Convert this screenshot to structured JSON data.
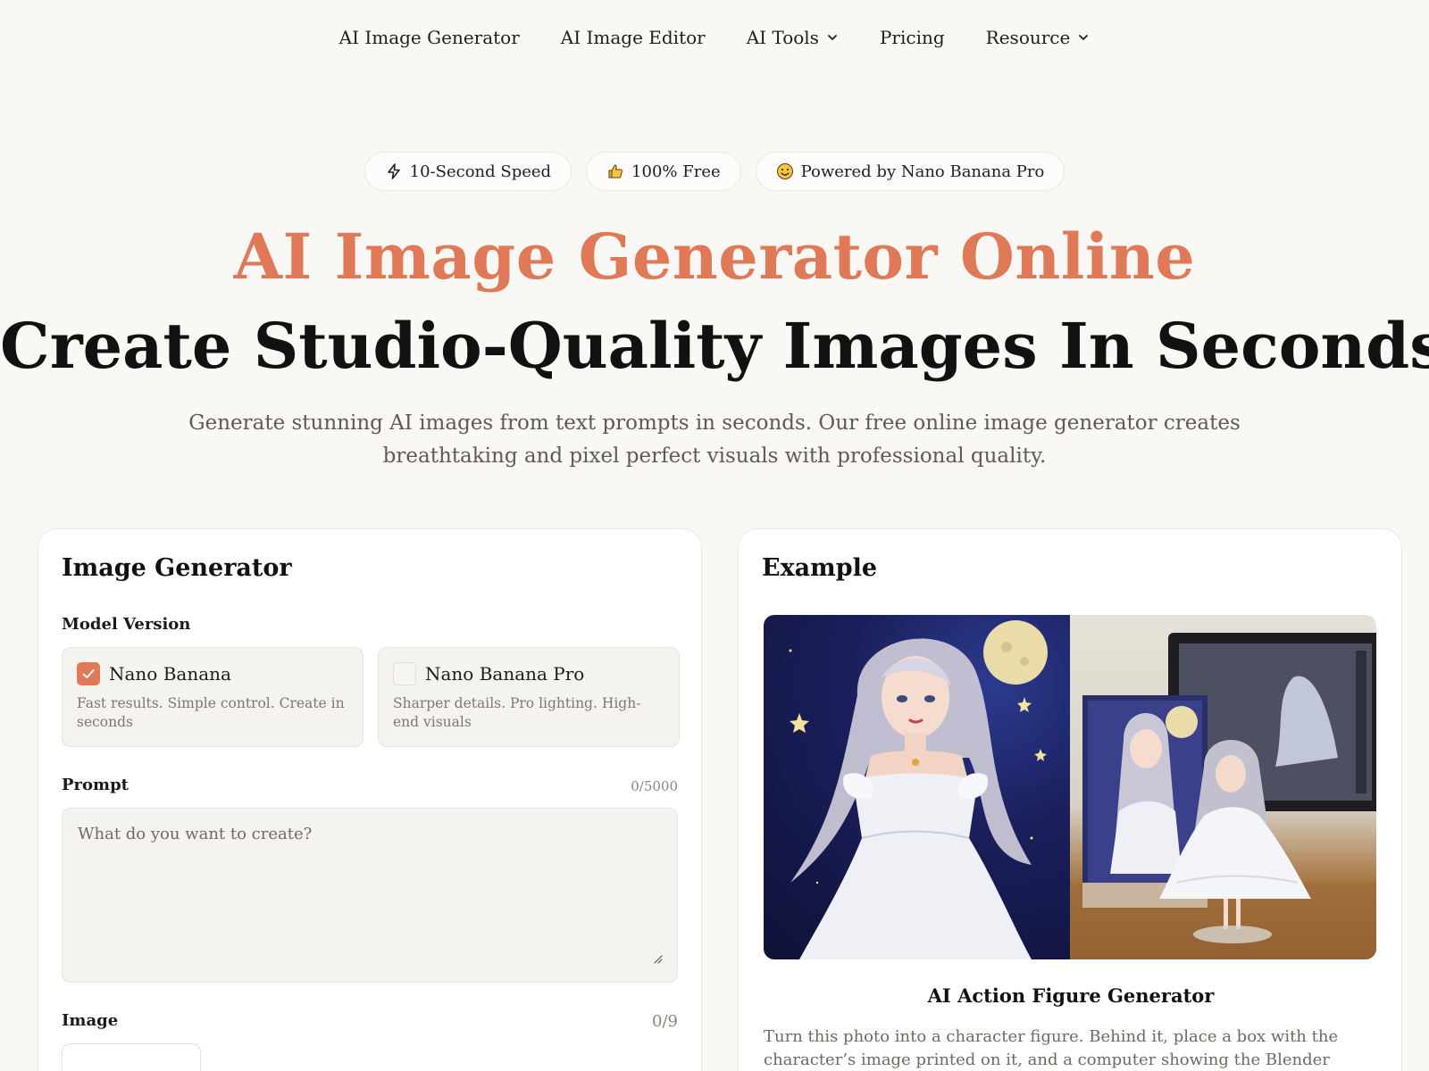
{
  "nav": {
    "items": [
      {
        "label": "AI Image Generator",
        "dropdown": false
      },
      {
        "label": "AI Image Editor",
        "dropdown": false
      },
      {
        "label": "AI Tools",
        "dropdown": true
      },
      {
        "label": "Pricing",
        "dropdown": false
      },
      {
        "label": "Resource",
        "dropdown": true
      }
    ]
  },
  "badges": [
    {
      "icon": "lightning-icon",
      "label": "10-Second Speed"
    },
    {
      "icon": "thumbs-up-icon",
      "label": "100% Free"
    },
    {
      "icon": "smiley-icon",
      "label": "Powered by Nano Banana Pro"
    }
  ],
  "hero": {
    "title": "AI Image Generator Online",
    "subtitle": "Create Studio-Quality Images In Seconds",
    "description": "Generate stunning AI images from text prompts in seconds. Our free online image generator creates breathtaking and pixel perfect visuals with professional quality."
  },
  "generator": {
    "title": "Image Generator",
    "model_label": "Model Version",
    "models": [
      {
        "name": "Nano Banana",
        "desc": "Fast results. Simple control. Create in seconds",
        "selected": true
      },
      {
        "name": "Nano Banana Pro",
        "desc": "Sharper details. Pro lighting. High-end visuals",
        "selected": false
      }
    ],
    "prompt_label": "Prompt",
    "prompt_counter": "0/5000",
    "prompt_placeholder": "What do you want to create?",
    "image_label": "Image",
    "image_counter": "0/9"
  },
  "example": {
    "title": "Example",
    "caption": "AI Action Figure Generator",
    "description": "Turn this photo into a character figure. Behind it, place a box with the character’s image printed on it, and a computer showing the Blender scene."
  },
  "colors": {
    "accent": "#df7957",
    "background": "#faf8f4",
    "card": "#ffffff"
  }
}
